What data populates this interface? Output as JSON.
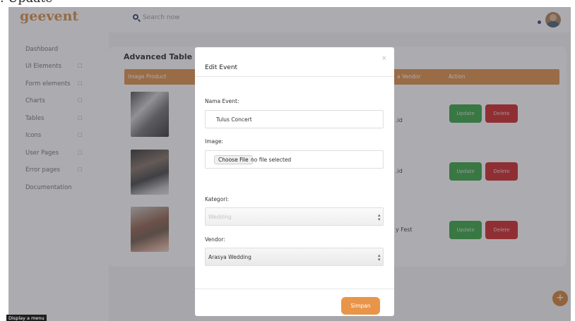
{
  "top_clip": ": Update",
  "header": {
    "logo": "geevent",
    "search_placeholder": "Search now"
  },
  "sidebar": {
    "items": [
      {
        "label": "Dashboard",
        "arrow": ""
      },
      {
        "label": "UI Elements",
        "arrow": "□"
      },
      {
        "label": "Form elements",
        "arrow": "□"
      },
      {
        "label": "Charts",
        "arrow": "□"
      },
      {
        "label": "Tables",
        "arrow": "□"
      },
      {
        "label": "Icons",
        "arrow": "□"
      },
      {
        "label": "User Pages",
        "arrow": "□"
      },
      {
        "label": "Error pages",
        "arrow": "□"
      },
      {
        "label": "Documentation",
        "arrow": ""
      }
    ]
  },
  "table": {
    "title": "Advanced Table",
    "columns": {
      "image_product": "Image Product",
      "vendor": "a Vendor",
      "action": "Action"
    },
    "rows": [
      {
        "vendor_fragment": ".id",
        "update": "Update",
        "delete": "Delete"
      },
      {
        "vendor_fragment": ".id",
        "update": "Update",
        "delete": "Delete"
      },
      {
        "vendor_fragment": "y Fest",
        "update": "Update",
        "delete": "Delete"
      }
    ]
  },
  "fab": "+",
  "modal": {
    "title": "Edit Event",
    "close": "×",
    "nama_event_label": "Nama Event:",
    "nama_event_value": "Tulus Concert",
    "image_label": "Image:",
    "choose_file": "Choose File",
    "no_file": "no file selected",
    "kategori_label": "Kategori:",
    "kategori_value": "Wedding",
    "vendor_label": "Vendor:",
    "vendor_value": "Arasya Wedding",
    "save": "Simpan"
  },
  "tooltip": "Display a menu"
}
